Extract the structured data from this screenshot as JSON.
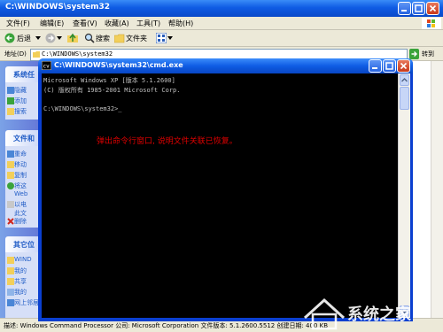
{
  "explorer": {
    "title": "C:\\WINDOWS\\system32",
    "menu": [
      "文件(F)",
      "编辑(E)",
      "查看(V)",
      "收藏(A)",
      "工具(T)",
      "帮助(H)"
    ],
    "toolbar": {
      "back": "后退",
      "search": "搜索",
      "folders": "文件夹"
    },
    "address": {
      "label": "地址(D)",
      "value": "C:\\WINDOWS\\system32",
      "go": "转到"
    }
  },
  "task_pane": {
    "system_tasks": {
      "header": "系统任",
      "items": [
        "隐藏",
        "添加",
        "搜索"
      ]
    },
    "file_tasks": {
      "header": "文件和",
      "items": [
        "重命",
        "移动",
        "复制",
        "将这",
        "Web",
        "以电",
        "此文",
        "删除"
      ]
    },
    "other_places": {
      "header": "其它位",
      "items": [
        "WIND",
        "我的",
        "共享",
        "我的",
        "网上邻居"
      ]
    }
  },
  "status_bar": {
    "text": "描述: Windows Command Processor 公司: Microsoft Corporation 文件版本: 5.1.2600.5512 创建日期: 400 KB"
  },
  "cmd": {
    "title": "C:\\WINDOWS\\system32\\cmd.exe",
    "lines": [
      "Microsoft Windows XP [版本 5.1.2600]",
      "(C) 版权所有 1985-2001 Microsoft Corp.",
      "",
      "C:\\WINDOWS\\system32>_"
    ],
    "annotation": "弹出命令行窗口, 说明文件关联已恢复。",
    "annotation_color": "#E00000"
  },
  "watermark": {
    "text": "系统之家"
  },
  "colors": {
    "xp_blue": "#0F5CE4",
    "task_pane": "#7BA2E7",
    "console_bg": "#000000",
    "console_fg": "#C0C0C0"
  }
}
